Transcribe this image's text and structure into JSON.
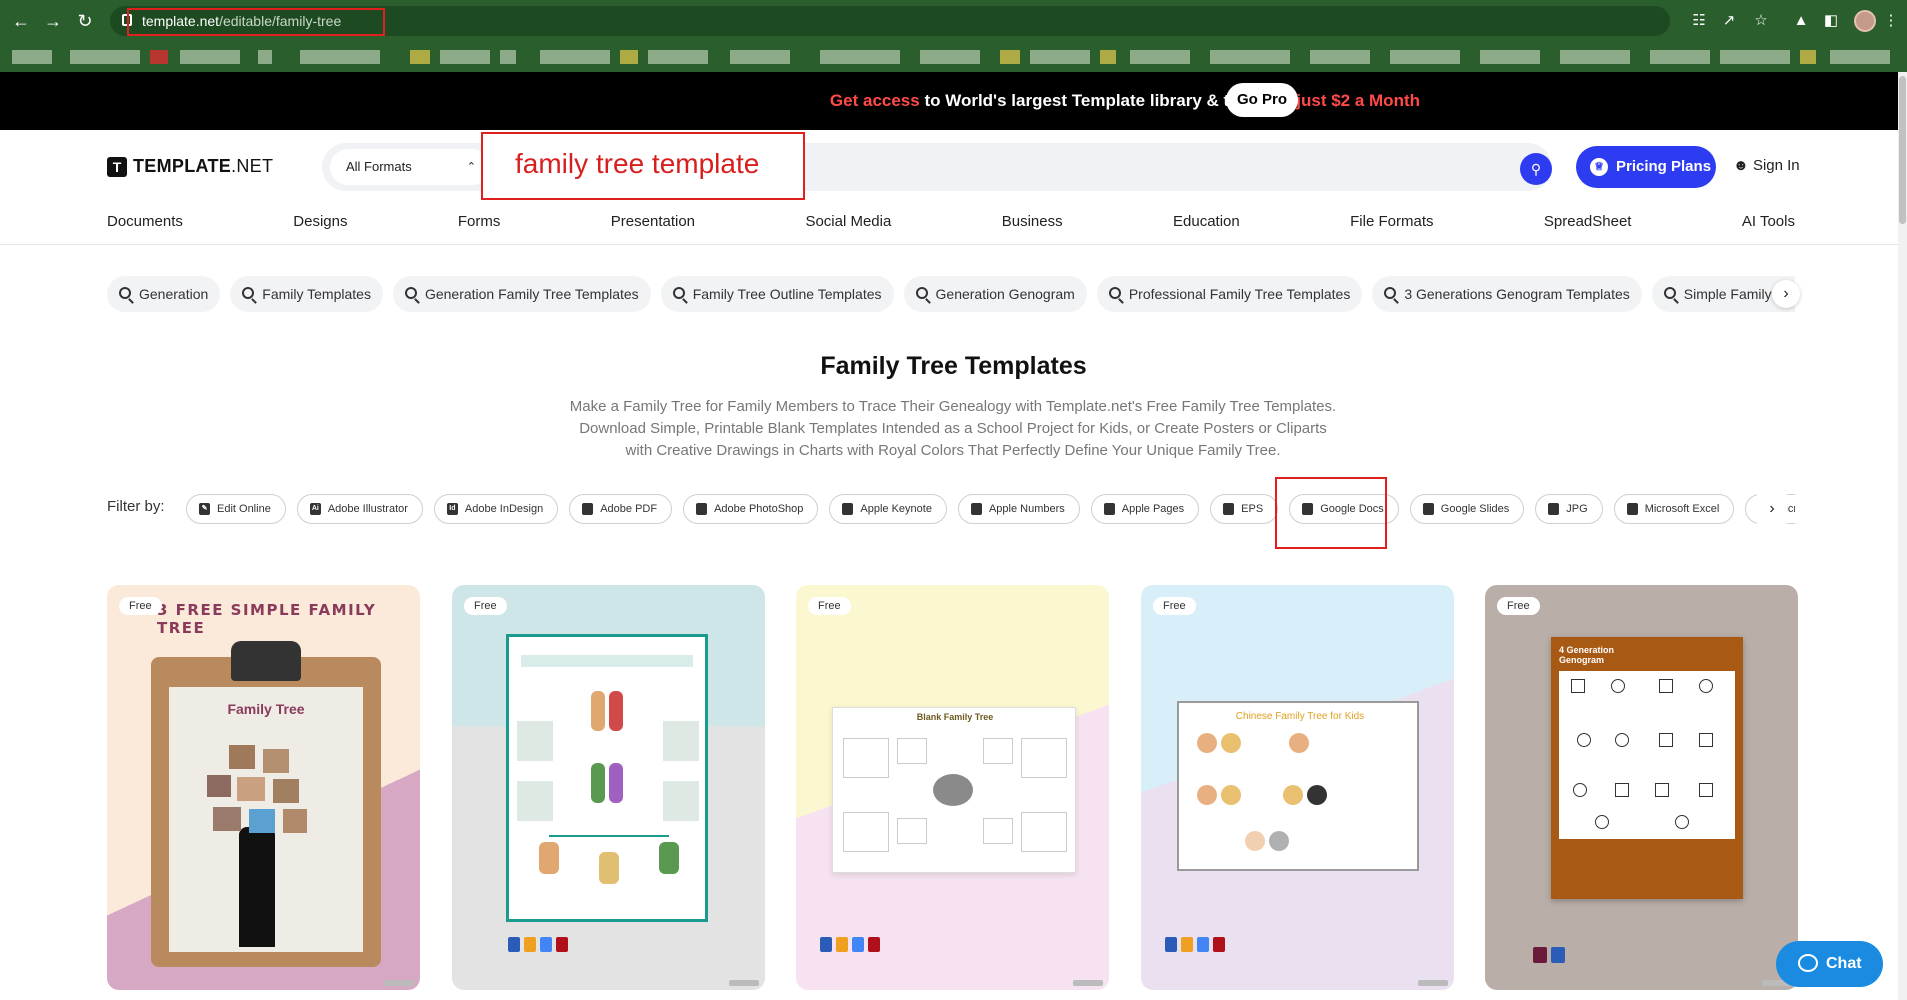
{
  "browser": {
    "url_host": "template.net",
    "url_path": "/editable/family-tree"
  },
  "promo": {
    "part1": "Get access",
    "part2": " to World's largest Template library & tools for ",
    "part3": "just $2 a Month",
    "cta": "Go Pro"
  },
  "header": {
    "logo_bold": "TEMPLATE",
    "logo_thin": ".NET",
    "format_select": "All Formats",
    "search_value": "family tree template",
    "pricing_label": "Pricing Plans",
    "signin_label": "Sign In"
  },
  "nav": [
    "Documents",
    "Designs",
    "Forms",
    "Presentation",
    "Social Media",
    "Business",
    "Education",
    "File Formats",
    "SpreadSheet",
    "AI Tools"
  ],
  "chips": [
    "Generation",
    "Family Templates",
    "Generation Family Tree Templates",
    "Family Tree Outline Templates",
    "Generation Genogram",
    "Professional Family Tree Templates",
    "3 Generations Genogram Templates",
    "Simple Family Tree Templates"
  ],
  "page": {
    "title": "Family Tree Templates",
    "description": "Make a Family Tree for Family Members to Trace Their Genealogy with Template.net's Free Family Tree Templates. Download Simple, Printable Blank Templates Intended as a School Project for Kids, or Create Posters or Cliparts with Creative Drawings in Charts with Royal Colors That Perfectly Define Your Unique Family Tree."
  },
  "filters": {
    "label": "Filter by:",
    "items": [
      {
        "label": "Edit Online",
        "icon": "pencil-icon"
      },
      {
        "label": "Adobe Illustrator",
        "icon": "illustrator-icon",
        "glyph": "Ai"
      },
      {
        "label": "Adobe InDesign",
        "icon": "indesign-icon",
        "glyph": "Id"
      },
      {
        "label": "Adobe PDF",
        "icon": "pdf-icon"
      },
      {
        "label": "Adobe PhotoShop",
        "icon": "photoshop-icon"
      },
      {
        "label": "Apple Keynote",
        "icon": "keynote-icon"
      },
      {
        "label": "Apple Numbers",
        "icon": "numbers-icon"
      },
      {
        "label": "Apple Pages",
        "icon": "pages-icon"
      },
      {
        "label": "EPS",
        "icon": "eps-icon"
      },
      {
        "label": "Google Docs",
        "icon": "google-docs-icon"
      },
      {
        "label": "Google Slides",
        "icon": "google-slides-icon"
      },
      {
        "label": "JPG",
        "icon": "jpg-icon"
      },
      {
        "label": "Microsoft Excel",
        "icon": "excel-icon"
      },
      {
        "label": "Microsoft Word",
        "icon": "word-icon"
      }
    ]
  },
  "cards": [
    {
      "badge": "Free",
      "heading": "3 FREE SIMPLE FAMILY TREE",
      "sub": "Family Tree"
    },
    {
      "badge": "Free"
    },
    {
      "badge": "Free",
      "heading": "Blank Family Tree"
    },
    {
      "badge": "Free",
      "heading": "Chinese Family Tree for Kids"
    },
    {
      "badge": "Free",
      "heading": "4 Generation Genogram"
    }
  ],
  "chat_label": "Chat",
  "colors": {
    "brand_blue": "#2d3cf0",
    "promo_red": "#ff4a4a",
    "annotation_red": "#e0201c",
    "chrome_green": "#2a5f2d"
  }
}
